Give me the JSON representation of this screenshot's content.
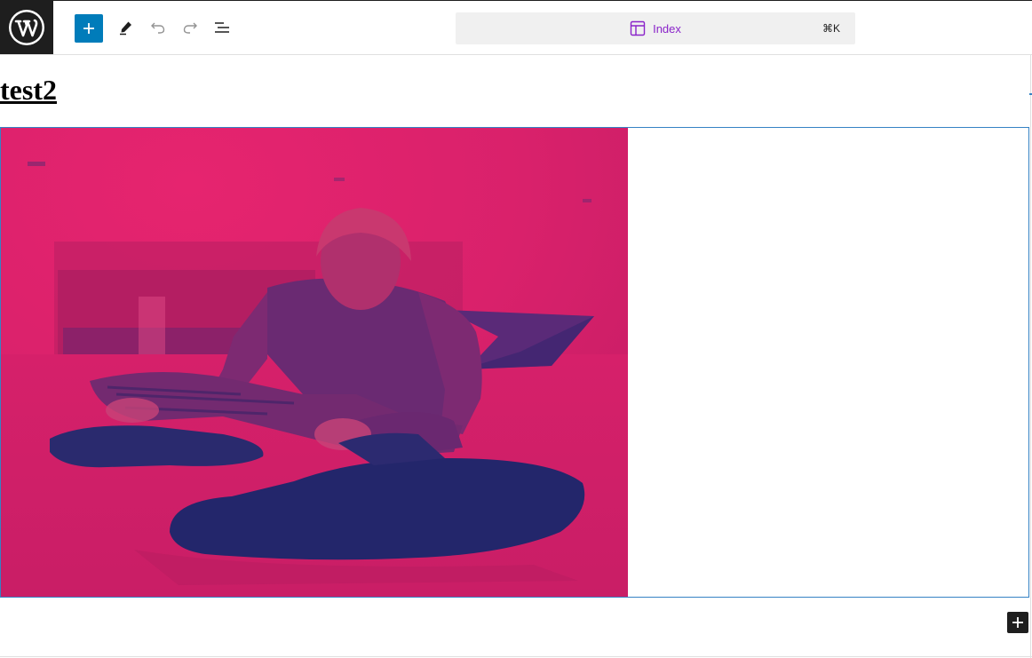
{
  "toolbar": {
    "logo_icon": "wordpress-logo-icon",
    "inserter_icon": "plus-icon",
    "edit_icon": "pencil-icon",
    "undo_icon": "undo-icon",
    "redo_icon": "redo-icon",
    "list_view_icon": "list-view-icon"
  },
  "command_bar": {
    "icon": "layout-template-icon",
    "title": "Index",
    "shortcut": "⌘K"
  },
  "canvas": {
    "site_title": "test2",
    "media_text_block": {
      "image_description": "duotone-photo",
      "content": ""
    },
    "appender_icon": "plus-icon"
  },
  "colors": {
    "accent": "#007cba",
    "duotone_highlight": "#e0246f",
    "duotone_shadow": "#23266b",
    "command_title": "#8a24c9",
    "block_outline": "#3582c4"
  }
}
